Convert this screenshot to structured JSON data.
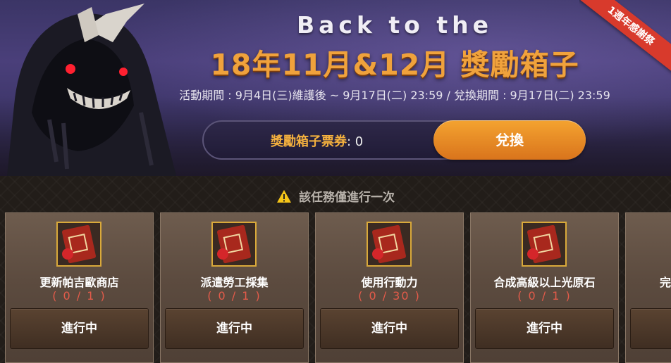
{
  "header": {
    "title_en": "Back to the",
    "title_cn": "18年11月&12月 獎勵箱子",
    "period": "活動期間 : 9月4日(三)維護後 ~ 9月17日(二) 23:59  /  兌換期間 : 9月17日(二) 23:59",
    "ribbon": "1週年感謝祭"
  },
  "ticket": {
    "label": "獎勵箱子票券",
    "colon": ": ",
    "count": "0",
    "exchange_button": "兌換"
  },
  "notice": "該任務僅進行一次",
  "quests": [
    {
      "title": "更新帕吉歐商店",
      "progress": "( 0 / 1 )",
      "button": "進行中"
    },
    {
      "title": "派遣勞工採集",
      "progress": "( 0 / 1 )",
      "button": "進行中"
    },
    {
      "title": "使用行動力",
      "progress": "( 0 / 30 )",
      "button": "進行中"
    },
    {
      "title": "合成高級以上光原石",
      "progress": "( 0 / 1 )",
      "button": "進行中"
    },
    {
      "title": "完",
      "progress": "",
      "button": ""
    }
  ],
  "colors": {
    "accent_orange": "#f0a23c",
    "progress_red": "#e35b4a",
    "ribbon_red": "#d83a2c"
  }
}
